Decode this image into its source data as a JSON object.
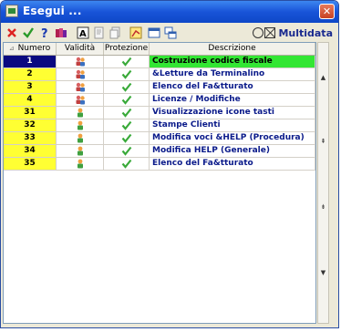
{
  "window": {
    "title": "Esegui ...",
    "close_label": "✕"
  },
  "brand": {
    "name": "Multidata"
  },
  "toolbar": {
    "items": [
      {
        "icon": "cancel-icon"
      },
      {
        "icon": "check-icon"
      },
      {
        "icon": "help-icon"
      },
      {
        "icon": "books-icon"
      },
      {
        "icon": "report-icon"
      },
      {
        "icon": "edit-page-icon"
      },
      {
        "icon": "copy-page-icon"
      },
      {
        "icon": "chart-icon"
      },
      {
        "icon": "window-icon"
      },
      {
        "icon": "window-tile-icon"
      }
    ]
  },
  "grid": {
    "columns": [
      "Numero",
      "Validità",
      "Protezione",
      "Descrizione"
    ],
    "sort_indicator": "⊿",
    "rows": [
      {
        "numero": "1",
        "validita": "group",
        "protezione": "check",
        "descrizione": "Costruzione codice fiscale",
        "selected": true
      },
      {
        "numero": "2",
        "validita": "group",
        "protezione": "check",
        "descrizione": "&Letture da Terminalino",
        "selected": false
      },
      {
        "numero": "3",
        "validita": "group",
        "protezione": "check",
        "descrizione": "Elenco del Fa&tturato",
        "selected": false
      },
      {
        "numero": "4",
        "validita": "group",
        "protezione": "check",
        "descrizione": "Licenze / Modifiche",
        "selected": false
      },
      {
        "numero": "31",
        "validita": "single",
        "protezione": "check",
        "descrizione": "Visualizzazione icone tasti",
        "selected": false
      },
      {
        "numero": "32",
        "validita": "single",
        "protezione": "check",
        "descrizione": "Stampe Clienti",
        "selected": false
      },
      {
        "numero": "33",
        "validita": "single",
        "protezione": "check",
        "descrizione": "Modifica voci &HELP (Procedura)",
        "selected": false
      },
      {
        "numero": "34",
        "validita": "single",
        "protezione": "check",
        "descrizione": "Modifica HELP (Generale)",
        "selected": false
      },
      {
        "numero": "35",
        "validita": "single",
        "protezione": "check",
        "descrizione": "Elenco del Fa&tturato",
        "selected": false
      }
    ]
  },
  "scrollbar": {
    "up": "▲",
    "page_up": "⇞",
    "page_down": "⇟",
    "down": "▼"
  },
  "colors": {
    "selected_number_bg": "#0a0a80",
    "selected_desc_bg": "#33e633",
    "number_bg": "#ffff33",
    "desc_text": "#0a1a8a"
  }
}
